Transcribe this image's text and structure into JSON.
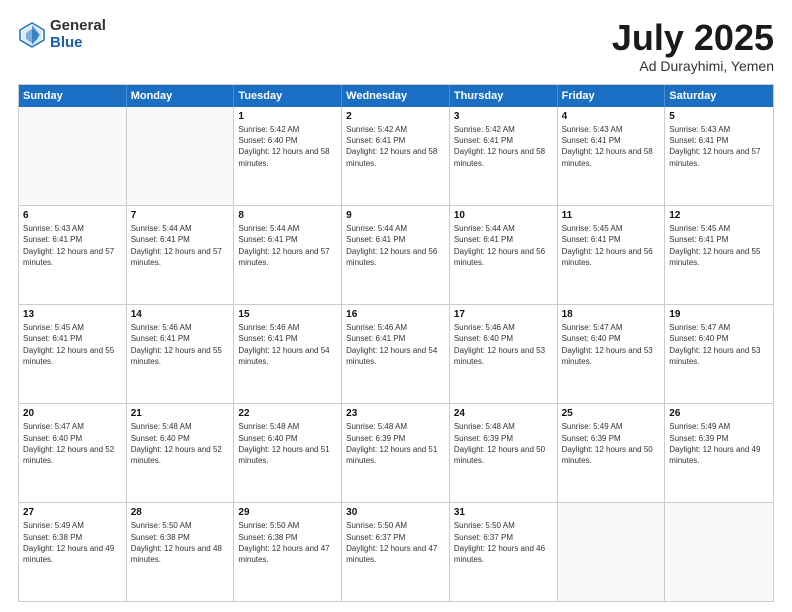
{
  "logo": {
    "general": "General",
    "blue": "Blue"
  },
  "header": {
    "month": "July 2025",
    "location": "Ad Durayhimi, Yemen"
  },
  "weekdays": [
    "Sunday",
    "Monday",
    "Tuesday",
    "Wednesday",
    "Thursday",
    "Friday",
    "Saturday"
  ],
  "weeks": [
    [
      {
        "day": "",
        "sunrise": "",
        "sunset": "",
        "daylight": ""
      },
      {
        "day": "",
        "sunrise": "",
        "sunset": "",
        "daylight": ""
      },
      {
        "day": "1",
        "sunrise": "Sunrise: 5:42 AM",
        "sunset": "Sunset: 6:40 PM",
        "daylight": "Daylight: 12 hours and 58 minutes."
      },
      {
        "day": "2",
        "sunrise": "Sunrise: 5:42 AM",
        "sunset": "Sunset: 6:41 PM",
        "daylight": "Daylight: 12 hours and 58 minutes."
      },
      {
        "day": "3",
        "sunrise": "Sunrise: 5:42 AM",
        "sunset": "Sunset: 6:41 PM",
        "daylight": "Daylight: 12 hours and 58 minutes."
      },
      {
        "day": "4",
        "sunrise": "Sunrise: 5:43 AM",
        "sunset": "Sunset: 6:41 PM",
        "daylight": "Daylight: 12 hours and 58 minutes."
      },
      {
        "day": "5",
        "sunrise": "Sunrise: 5:43 AM",
        "sunset": "Sunset: 6:41 PM",
        "daylight": "Daylight: 12 hours and 57 minutes."
      }
    ],
    [
      {
        "day": "6",
        "sunrise": "Sunrise: 5:43 AM",
        "sunset": "Sunset: 6:41 PM",
        "daylight": "Daylight: 12 hours and 57 minutes."
      },
      {
        "day": "7",
        "sunrise": "Sunrise: 5:44 AM",
        "sunset": "Sunset: 6:41 PM",
        "daylight": "Daylight: 12 hours and 57 minutes."
      },
      {
        "day": "8",
        "sunrise": "Sunrise: 5:44 AM",
        "sunset": "Sunset: 6:41 PM",
        "daylight": "Daylight: 12 hours and 57 minutes."
      },
      {
        "day": "9",
        "sunrise": "Sunrise: 5:44 AM",
        "sunset": "Sunset: 6:41 PM",
        "daylight": "Daylight: 12 hours and 56 minutes."
      },
      {
        "day": "10",
        "sunrise": "Sunrise: 5:44 AM",
        "sunset": "Sunset: 6:41 PM",
        "daylight": "Daylight: 12 hours and 56 minutes."
      },
      {
        "day": "11",
        "sunrise": "Sunrise: 5:45 AM",
        "sunset": "Sunset: 6:41 PM",
        "daylight": "Daylight: 12 hours and 56 minutes."
      },
      {
        "day": "12",
        "sunrise": "Sunrise: 5:45 AM",
        "sunset": "Sunset: 6:41 PM",
        "daylight": "Daylight: 12 hours and 55 minutes."
      }
    ],
    [
      {
        "day": "13",
        "sunrise": "Sunrise: 5:45 AM",
        "sunset": "Sunset: 6:41 PM",
        "daylight": "Daylight: 12 hours and 55 minutes."
      },
      {
        "day": "14",
        "sunrise": "Sunrise: 5:46 AM",
        "sunset": "Sunset: 6:41 PM",
        "daylight": "Daylight: 12 hours and 55 minutes."
      },
      {
        "day": "15",
        "sunrise": "Sunrise: 5:46 AM",
        "sunset": "Sunset: 6:41 PM",
        "daylight": "Daylight: 12 hours and 54 minutes."
      },
      {
        "day": "16",
        "sunrise": "Sunrise: 5:46 AM",
        "sunset": "Sunset: 6:41 PM",
        "daylight": "Daylight: 12 hours and 54 minutes."
      },
      {
        "day": "17",
        "sunrise": "Sunrise: 5:46 AM",
        "sunset": "Sunset: 6:40 PM",
        "daylight": "Daylight: 12 hours and 53 minutes."
      },
      {
        "day": "18",
        "sunrise": "Sunrise: 5:47 AM",
        "sunset": "Sunset: 6:40 PM",
        "daylight": "Daylight: 12 hours and 53 minutes."
      },
      {
        "day": "19",
        "sunrise": "Sunrise: 5:47 AM",
        "sunset": "Sunset: 6:40 PM",
        "daylight": "Daylight: 12 hours and 53 minutes."
      }
    ],
    [
      {
        "day": "20",
        "sunrise": "Sunrise: 5:47 AM",
        "sunset": "Sunset: 6:40 PM",
        "daylight": "Daylight: 12 hours and 52 minutes."
      },
      {
        "day": "21",
        "sunrise": "Sunrise: 5:48 AM",
        "sunset": "Sunset: 6:40 PM",
        "daylight": "Daylight: 12 hours and 52 minutes."
      },
      {
        "day": "22",
        "sunrise": "Sunrise: 5:48 AM",
        "sunset": "Sunset: 6:40 PM",
        "daylight": "Daylight: 12 hours and 51 minutes."
      },
      {
        "day": "23",
        "sunrise": "Sunrise: 5:48 AM",
        "sunset": "Sunset: 6:39 PM",
        "daylight": "Daylight: 12 hours and 51 minutes."
      },
      {
        "day": "24",
        "sunrise": "Sunrise: 5:48 AM",
        "sunset": "Sunset: 6:39 PM",
        "daylight": "Daylight: 12 hours and 50 minutes."
      },
      {
        "day": "25",
        "sunrise": "Sunrise: 5:49 AM",
        "sunset": "Sunset: 6:39 PM",
        "daylight": "Daylight: 12 hours and 50 minutes."
      },
      {
        "day": "26",
        "sunrise": "Sunrise: 5:49 AM",
        "sunset": "Sunset: 6:39 PM",
        "daylight": "Daylight: 12 hours and 49 minutes."
      }
    ],
    [
      {
        "day": "27",
        "sunrise": "Sunrise: 5:49 AM",
        "sunset": "Sunset: 6:38 PM",
        "daylight": "Daylight: 12 hours and 49 minutes."
      },
      {
        "day": "28",
        "sunrise": "Sunrise: 5:50 AM",
        "sunset": "Sunset: 6:38 PM",
        "daylight": "Daylight: 12 hours and 48 minutes."
      },
      {
        "day": "29",
        "sunrise": "Sunrise: 5:50 AM",
        "sunset": "Sunset: 6:38 PM",
        "daylight": "Daylight: 12 hours and 47 minutes."
      },
      {
        "day": "30",
        "sunrise": "Sunrise: 5:50 AM",
        "sunset": "Sunset: 6:37 PM",
        "daylight": "Daylight: 12 hours and 47 minutes."
      },
      {
        "day": "31",
        "sunrise": "Sunrise: 5:50 AM",
        "sunset": "Sunset: 6:37 PM",
        "daylight": "Daylight: 12 hours and 46 minutes."
      },
      {
        "day": "",
        "sunrise": "",
        "sunset": "",
        "daylight": ""
      },
      {
        "day": "",
        "sunrise": "",
        "sunset": "",
        "daylight": ""
      }
    ]
  ]
}
